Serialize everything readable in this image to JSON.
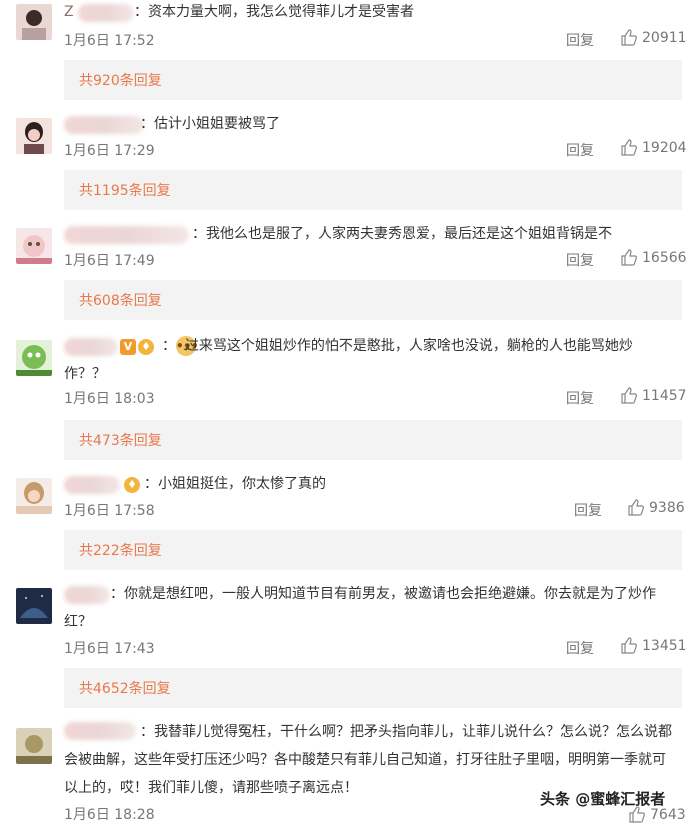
{
  "comments": [
    {
      "text": "：资本力量大啊，我怎么觉得菲儿才是受害者",
      "username_prefix": "Z",
      "date": "1月6日 17:52",
      "reply_label": "回复",
      "likes": "20911",
      "more": "共920条回复"
    },
    {
      "text": "：估计小姐姐要被骂了",
      "date": "1月6日 17:29",
      "reply_label": "回复",
      "likes": "19204",
      "more": "共1195条回复"
    },
    {
      "text": "：我他么也是服了，人家两夫妻秀恩爱，最后还是这个姐姐背锅是不",
      "date": "1月6日 17:49",
      "reply_label": "回复",
      "likes": "16566",
      "more": "共608条回复"
    },
    {
      "text_line1": "：  过来骂这个姐姐炒作的怕不是憨批，人家啥也没说，躺枪的人也能骂她炒",
      "text_line2": "作？？",
      "date": "1月6日 18:03",
      "reply_label": "回复",
      "likes": "11457",
      "more": "共473条回复"
    },
    {
      "text": "：小姐姐挺住，你太惨了真的",
      "date": "1月6日 17:58",
      "reply_label": "回复",
      "likes": "9386",
      "more": "共222条回复"
    },
    {
      "text_line1": "：你就是想红吧，一般人明知道节目有前男友，被邀请也会拒绝避嫌。你去就是为了炒作",
      "text_line2": "红？",
      "date": "1月6日 17:43",
      "reply_label": "回复",
      "likes": "13451",
      "more": "共4652条回复"
    },
    {
      "text_line1": "：我替菲儿觉得冤枉，干什么啊？把矛头指向菲儿，让菲儿说什么？怎么说？怎么说都",
      "text_line2": "会被曲解，这些年受打压还少吗？各中酸楚只有菲儿自己知道，打牙往肚子里咽，明明第一季就可",
      "text_line3": "以上的，哎！我们菲儿傻，请那些喷子离远点！",
      "date": "1月6日 18:28",
      "likes": "7643"
    }
  ],
  "watermark": "头条 @蜜蜂汇报者",
  "colors": {
    "link": "#e8794c",
    "meta": "#777777",
    "bar": "#f3f3f3"
  }
}
